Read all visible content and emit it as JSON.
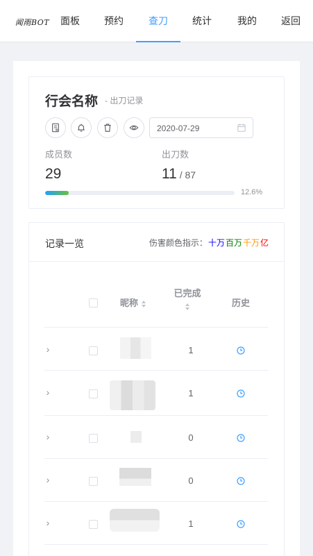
{
  "nav": {
    "logo": "闻雨BOT",
    "items": [
      {
        "label": "面板"
      },
      {
        "label": "预约"
      },
      {
        "label": "查刀"
      },
      {
        "label": "统计"
      },
      {
        "label": "我的"
      },
      {
        "label": "返回"
      }
    ],
    "active_index": 2
  },
  "guild": {
    "name": "行会名称",
    "subtitle": "- 出刀记录",
    "date": "2020-07-29",
    "members_label": "成员数",
    "members_value": "29",
    "attacks_label": "出刀数",
    "attacks_done": "11",
    "attacks_total": " / 87",
    "progress_percent": 12.6,
    "progress_text": "12.6%"
  },
  "records": {
    "title": "记录一览",
    "legend_prefix": "伤害颜色指示：",
    "legend_items": [
      {
        "label": "十万",
        "color": "#0000ff"
      },
      {
        "label": "百万",
        "color": "#008000"
      },
      {
        "label": "千万",
        "color": "#ff9900"
      },
      {
        "label": "亿",
        "color": "#ff0000"
      }
    ],
    "columns": {
      "nickname": "昵称",
      "completed": "已完成",
      "history": "历史"
    },
    "rows": [
      {
        "completed": "1"
      },
      {
        "completed": "1"
      },
      {
        "completed": "0"
      },
      {
        "completed": "0"
      },
      {
        "completed": "1"
      }
    ]
  },
  "colors": {
    "accent": "#409eff",
    "progress_start": "#20a0ff",
    "progress_end": "#67c23a"
  }
}
